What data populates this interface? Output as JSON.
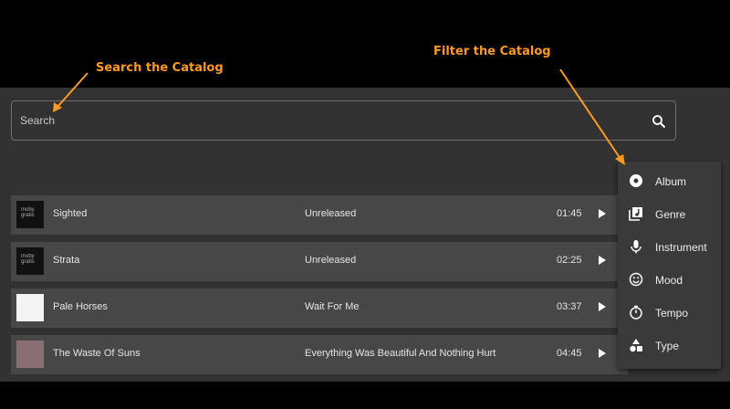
{
  "annotations": {
    "search_callout": "Search the Catalog",
    "filter_callout": "Filter the Catalog",
    "color": "#ff9a1f"
  },
  "search": {
    "placeholder": "Search",
    "icon": "search-icon"
  },
  "tracks": [
    {
      "title": "Sighted",
      "album": "Unreleased",
      "duration": "01:45",
      "thumb_text": "moby gratis"
    },
    {
      "title": "Strata",
      "album": "Unreleased",
      "duration": "02:25",
      "thumb_text": "moby gratis"
    },
    {
      "title": "Pale Horses",
      "album": "Wait For Me",
      "duration": "03:37"
    },
    {
      "title": "The Waste Of Suns",
      "album": "Everything Was Beautiful And Nothing Hurt",
      "duration": "04:45"
    }
  ],
  "filter_menu": {
    "items": [
      {
        "label": "Album",
        "icon": "album-icon"
      },
      {
        "label": "Genre",
        "icon": "genre-icon"
      },
      {
        "label": "Instrument",
        "icon": "microphone-icon"
      },
      {
        "label": "Mood",
        "icon": "smiley-icon"
      },
      {
        "label": "Tempo",
        "icon": "stopwatch-icon"
      },
      {
        "label": "Type",
        "icon": "shapes-icon"
      }
    ]
  }
}
